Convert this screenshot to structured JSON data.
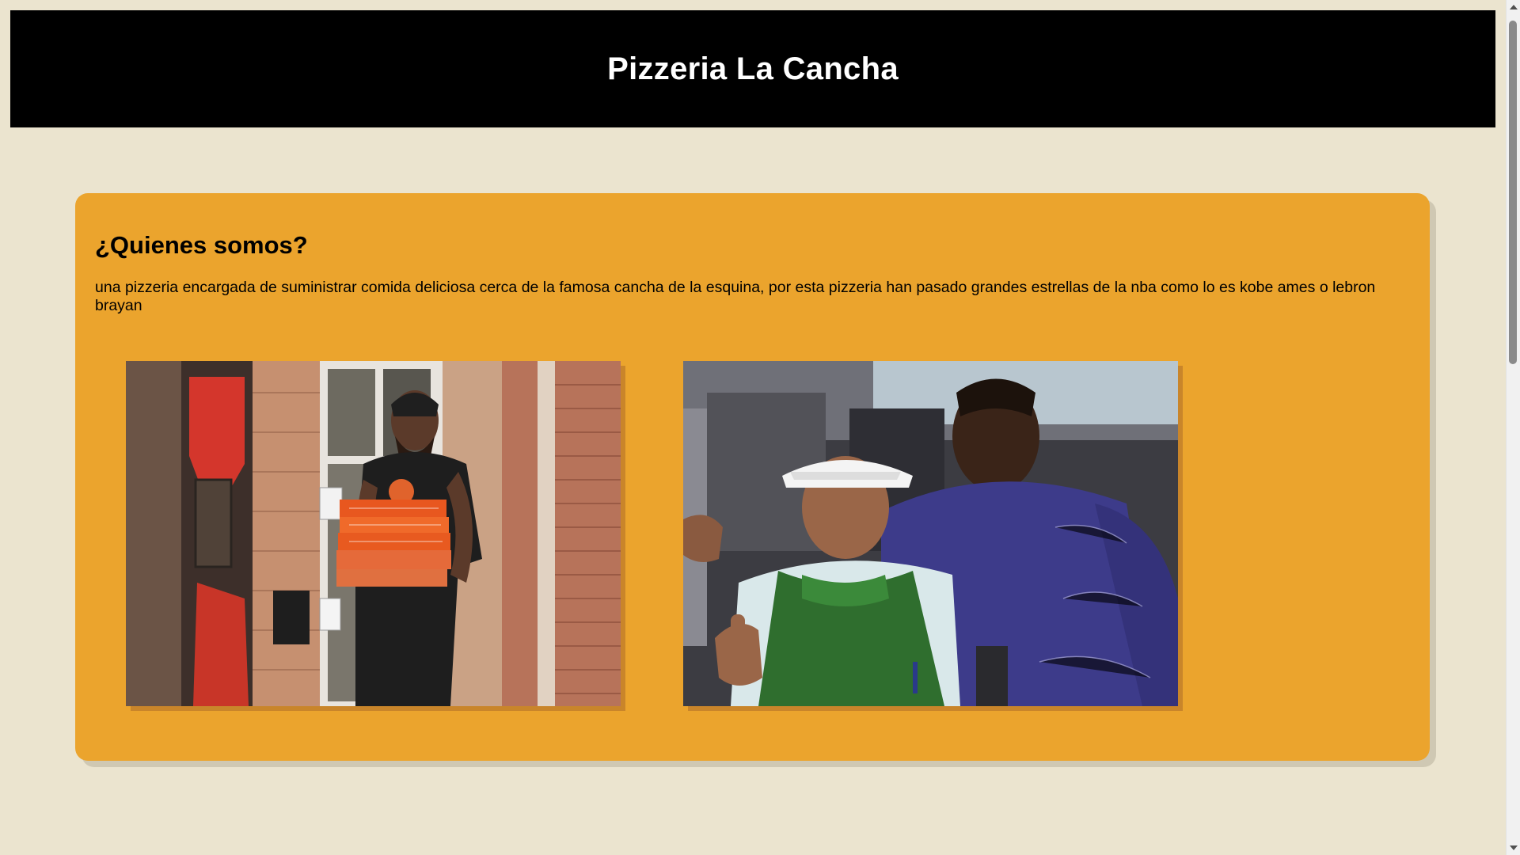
{
  "header": {
    "title": "Pizzeria La Cancha"
  },
  "about": {
    "heading": "¿Quienes somos?",
    "text": "una pizzeria encargada de suministrar comida deliciosa cerca de la famosa cancha de la esquina, por esta pizzeria han pasado grandes estrellas de la nba como lo es kobe ames o lebron brayan"
  },
  "photos": [
    {
      "name": "photo-player-carrying-pizza-boxes"
    },
    {
      "name": "photo-chef-with-player"
    }
  ],
  "colors": {
    "background": "#ebe4cf",
    "header": "#000000",
    "card": "#eba42d"
  }
}
